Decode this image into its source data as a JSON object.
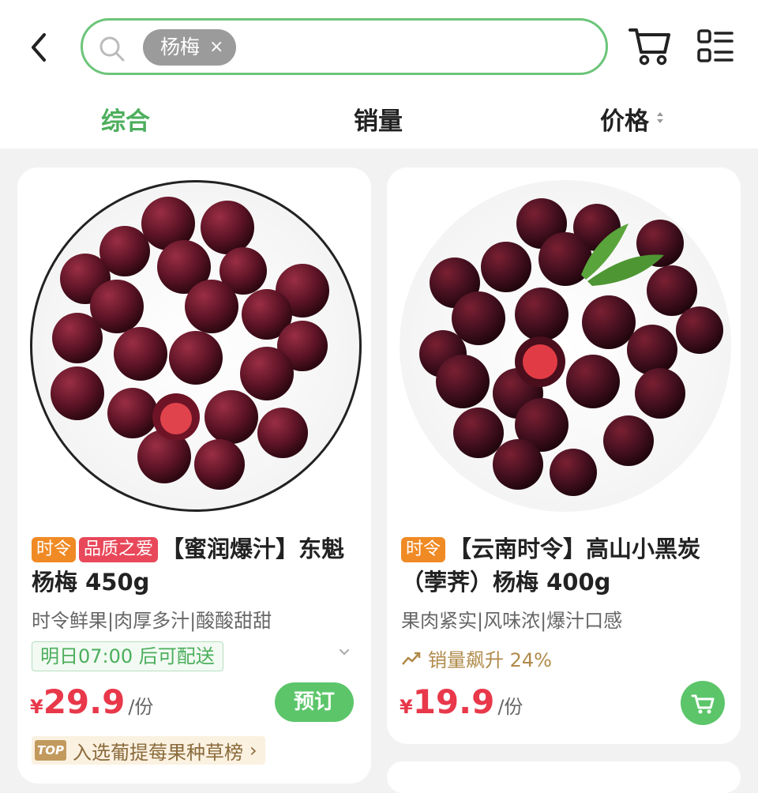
{
  "search": {
    "query_chip": "杨梅",
    "clear": "×"
  },
  "tabs": [
    {
      "label": "综合",
      "active": true
    },
    {
      "label": "销量",
      "active": false
    },
    {
      "label": "价格",
      "active": false
    }
  ],
  "products": [
    {
      "tags": [
        "时令",
        "品质之爱"
      ],
      "title": "【蜜润爆汁】东魁杨梅 450g",
      "subtitle": "时令鲜果|肉厚多汁|酸酸甜甜",
      "delivery": "明日07:00 后可配送",
      "price_symbol": "¥",
      "price": "29.9",
      "unit": "/份",
      "action_label": "预订",
      "rank_badge": "TOP",
      "rank_text": "入选葡提莓果种草榜",
      "rank_arrow": "›"
    },
    {
      "tags": [
        "时令"
      ],
      "title": "【云南时令】高山小黑炭（荸荠）杨梅 400g",
      "subtitle": "果肉紧实|风味浓|爆汁口感",
      "trend": "销量飙升 24%",
      "price_symbol": "¥",
      "price": "19.9",
      "unit": "/份"
    }
  ],
  "colors": {
    "accent_green": "#5cc56a",
    "price_red": "#e8384a",
    "tag_orange": "#f08a24",
    "tag_red": "#e8485a"
  },
  "icons": [
    "back-arrow-icon",
    "search-icon",
    "cart-icon",
    "list-view-icon",
    "sort-arrows-icon",
    "chevron-down-icon",
    "trend-up-icon"
  ]
}
